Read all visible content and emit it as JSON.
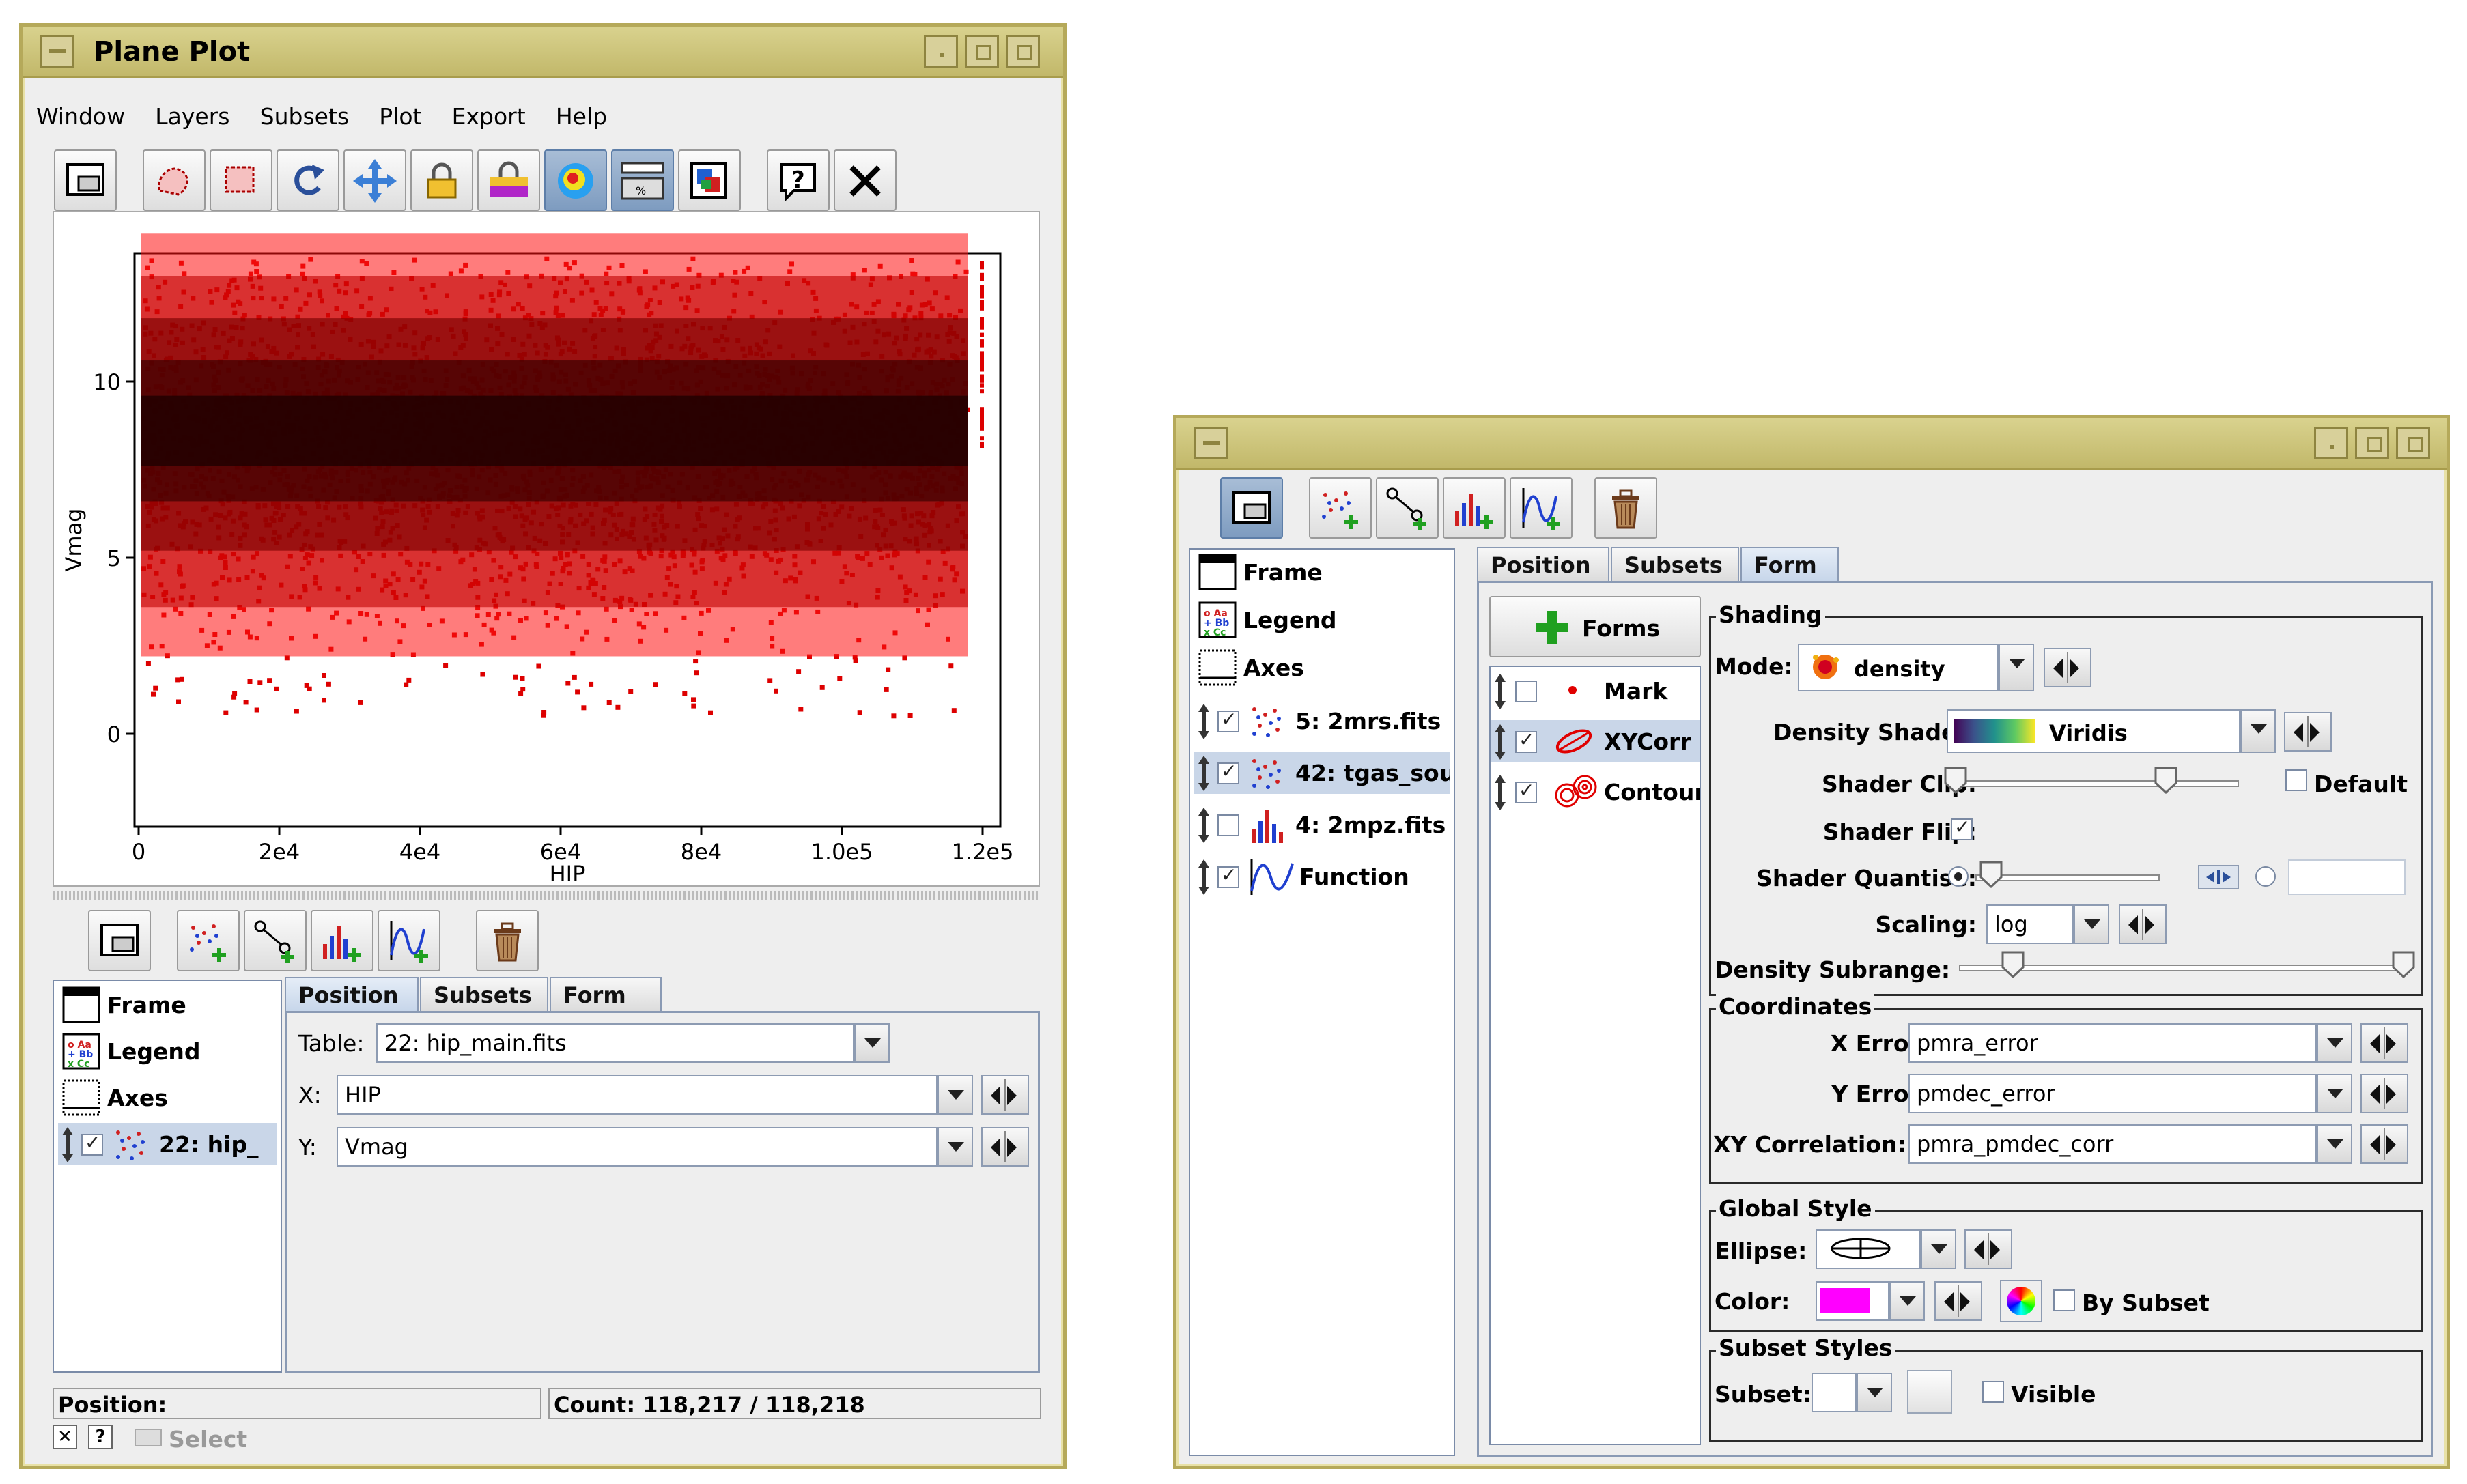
{
  "left_window": {
    "title": "Plane Plot",
    "menus": [
      "Window",
      "Layers",
      "Subsets",
      "Plot",
      "Export",
      "Help"
    ],
    "plot": {
      "xlabel": "HIP",
      "ylabel": "Vmag",
      "xticks": [
        "0",
        "2e4",
        "4e4",
        "6e4",
        "8e4",
        "1.0e5",
        "1.2e5"
      ],
      "yticks": [
        "0",
        "5",
        "10"
      ]
    },
    "layers": {
      "fixed": [
        "Frame",
        "Legend",
        "Axes"
      ],
      "dataset": "22: hip_"
    },
    "tabs": [
      "Position",
      "Subsets",
      "Form"
    ],
    "position": {
      "table_label": "Table:",
      "table_value": "22: hip_main.fits",
      "x_label": "X:",
      "x_value": "HIP",
      "y_label": "Y:",
      "y_value": "Vmag"
    },
    "status": {
      "position_label": "Position:",
      "count": "Count: 118,217 / 118,218",
      "select": "Select"
    }
  },
  "right_window": {
    "layers": {
      "fixed": [
        "Frame",
        "Legend",
        "Axes"
      ],
      "datasets": [
        "5: 2mrs.fits",
        "42: tgas_sou",
        "4: 2mpz.fits",
        "Function"
      ]
    },
    "tabs": [
      "Position",
      "Subsets",
      "Form"
    ],
    "forms_button": "Forms",
    "forms": [
      "Mark",
      "XYCorr",
      "Contour"
    ],
    "shading": {
      "title": "Shading",
      "mode_label": "Mode:",
      "mode_value": "density",
      "density_shader_label": "Density Shader:",
      "density_shader_value": "Viridis",
      "shader_clip_label": "Shader Clip:",
      "default_label": "Default",
      "shader_flip_label": "Shader Flip:",
      "shader_quantise_label": "Shader Quantise:",
      "scaling_label": "Scaling:",
      "scaling_value": "log",
      "density_subrange_label": "Density Subrange:"
    },
    "coordinates": {
      "title": "Coordinates",
      "x_error_label": "X Error:",
      "x_error_value": "pmra_error",
      "y_error_label": "Y Error:",
      "y_error_value": "pmdec_error",
      "xy_corr_label": "XY Correlation:",
      "xy_corr_value": "pmra_pmdec_corr"
    },
    "global_style": {
      "title": "Global Style",
      "ellipse_label": "Ellipse:",
      "color_label": "Color:",
      "color_value": "#ff00ff",
      "by_subset_label": "By Subset"
    },
    "subset_styles": {
      "title": "Subset Styles",
      "subset_label": "Subset:",
      "visible_label": "Visible"
    }
  },
  "colors": {
    "title_bar": "#c8be72",
    "selection": "#c9d6e8",
    "points": "#dd0000"
  }
}
